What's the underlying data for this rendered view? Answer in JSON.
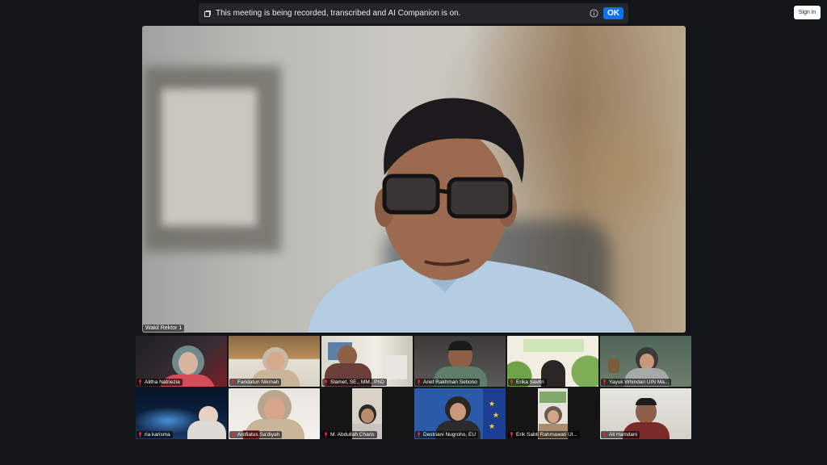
{
  "banner": {
    "text": "This meeting is being recorded, transcribed and AI Companion is on.",
    "ok_label": "OK",
    "icons": [
      "recording-icon",
      "info-icon"
    ]
  },
  "signin_label": "Sign in",
  "main_speaker": {
    "name": "Wakil Rektor 1"
  },
  "participants": [
    {
      "name": "Alitha Natriezia"
    },
    {
      "name": "Faridatun Nikmah"
    },
    {
      "name": "Slamet, SE., MM., PhD"
    },
    {
      "name": "Arief Rakhman Setiono"
    },
    {
      "name": "Erika Savitri"
    },
    {
      "name": "Yayuk Whindari UIN Ma..."
    },
    {
      "name": "ria karisma"
    },
    {
      "name": "Arofiatus Sa'diyah"
    },
    {
      "name": "M. Abdullah Charis"
    },
    {
      "name": "Destriani Nugroho, EU"
    },
    {
      "name": "Erik Sabti Rahmawati UI..."
    },
    {
      "name": "Ali Hamdani"
    }
  ],
  "colors": {
    "background": "#131619",
    "accent": "#0e72ed",
    "muted_mic": "#e02828"
  }
}
